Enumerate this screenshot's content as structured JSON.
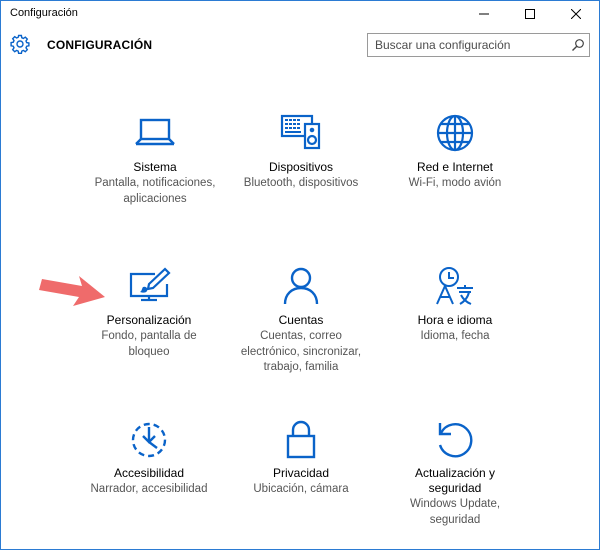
{
  "window": {
    "title": "Configuración"
  },
  "header": {
    "title": "CONFIGURACIÓN"
  },
  "search": {
    "placeholder": "Buscar una configuración"
  },
  "tiles": [
    {
      "name": "Sistema",
      "desc": "Pantalla, notificaciones, aplicaciones",
      "icon": "laptop-icon"
    },
    {
      "name": "Dispositivos",
      "desc": "Bluetooth, dispositivos",
      "icon": "devices-icon"
    },
    {
      "name": "Red e Internet",
      "desc": "Wi-Fi, modo avión",
      "icon": "globe-icon"
    },
    {
      "name": "Personalización",
      "desc": "Fondo, pantalla de bloqueo",
      "icon": "personalization-icon"
    },
    {
      "name": "Cuentas",
      "desc": "Cuentas, correo electrónico, sincronizar, trabajo, familia",
      "icon": "person-icon"
    },
    {
      "name": "Hora e idioma",
      "desc": "Idioma, fecha",
      "icon": "time-language-icon"
    },
    {
      "name": "Accesibilidad",
      "desc": "Narrador, accesibilidad",
      "icon": "ease-of-access-icon"
    },
    {
      "name": "Privacidad",
      "desc": "Ubicación, cámara",
      "icon": "lock-icon"
    },
    {
      "name": "Actualización y seguridad",
      "desc": "Windows Update, seguridad",
      "icon": "update-icon"
    }
  ],
  "colors": {
    "accent": "#0a63c9",
    "arrow": "#ef6b6b"
  }
}
